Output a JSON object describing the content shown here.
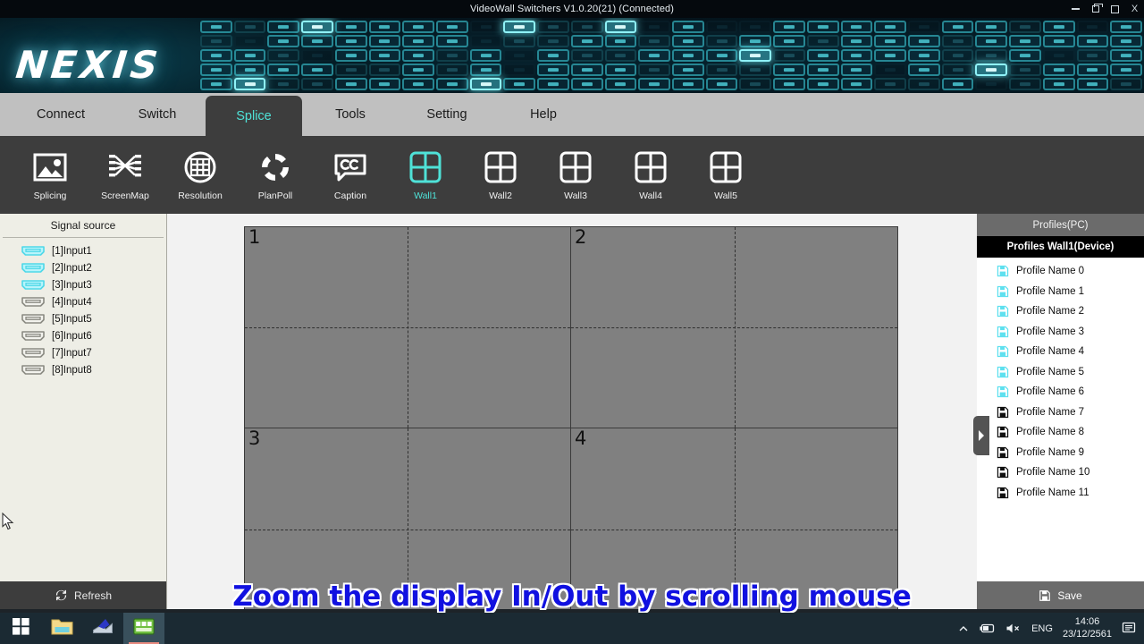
{
  "window": {
    "title": "VideoWall Switchers V1.0.20(21) (Connected)",
    "minimize_label": "Minimize",
    "restore_label": "Restore",
    "maximize_label": "Maximize",
    "close_label": "X"
  },
  "branding": {
    "logo_text": "NEXIS"
  },
  "menu": {
    "tabs": [
      {
        "label": "Connect",
        "active": false
      },
      {
        "label": "Switch",
        "active": false
      },
      {
        "label": "Splice",
        "active": true
      },
      {
        "label": "Tools",
        "active": false
      },
      {
        "label": "Setting",
        "active": false
      },
      {
        "label": "Help",
        "active": false
      }
    ]
  },
  "toolbar": {
    "buttons": [
      {
        "label": "Splicing",
        "icon": "image-icon",
        "active": false
      },
      {
        "label": "ScreenMap",
        "icon": "screenmap-icon",
        "active": false
      },
      {
        "label": "Resolution",
        "icon": "resolution-grid-circle-icon",
        "active": false
      },
      {
        "label": "PlanPoll",
        "icon": "refresh-circle-icon",
        "active": false
      },
      {
        "label": "Caption",
        "icon": "cc-bubble-icon",
        "active": false
      }
    ],
    "walls": [
      {
        "label": "Wall1",
        "icon": "grid-2x2-icon",
        "active": true
      },
      {
        "label": "Wall2",
        "icon": "grid-2x2-icon",
        "active": false
      },
      {
        "label": "Wall3",
        "icon": "grid-2x2-icon",
        "active": false
      },
      {
        "label": "Wall4",
        "icon": "grid-2x2-icon",
        "active": false
      },
      {
        "label": "Wall5",
        "icon": "grid-2x2-icon",
        "active": false
      }
    ]
  },
  "signal_source": {
    "header": "Signal source",
    "items": [
      {
        "label": "[1]Input1",
        "connected": true
      },
      {
        "label": "[2]Input2",
        "connected": true
      },
      {
        "label": "[3]Input3",
        "connected": true
      },
      {
        "label": "[4]Input4",
        "connected": false
      },
      {
        "label": "[5]Input5",
        "connected": false
      },
      {
        "label": "[6]Input6",
        "connected": false
      },
      {
        "label": "[7]Input7",
        "connected": false
      },
      {
        "label": "[8]Input8",
        "connected": false
      }
    ],
    "refresh_label": "Refresh",
    "refresh_icon": "refresh-icon"
  },
  "wall_canvas": {
    "screens": [
      "1",
      "2",
      "3",
      "4"
    ],
    "rows": 2,
    "columns": 2,
    "subdivision_rows": 2,
    "subdivision_columns": 2
  },
  "profiles": {
    "header": "Profiles(PC)",
    "subheader": "Profiles Wall1(Device)",
    "items": [
      {
        "label": "Profile Name 0",
        "saved": true
      },
      {
        "label": "Profile Name 1",
        "saved": true
      },
      {
        "label": "Profile Name 2",
        "saved": true
      },
      {
        "label": "Profile Name 3",
        "saved": true
      },
      {
        "label": "Profile Name 4",
        "saved": true
      },
      {
        "label": "Profile Name 5",
        "saved": true
      },
      {
        "label": "Profile Name 6",
        "saved": true
      },
      {
        "label": "Profile Name 7",
        "saved": false
      },
      {
        "label": "Profile Name 8",
        "saved": false
      },
      {
        "label": "Profile Name 9",
        "saved": false
      },
      {
        "label": "Profile Name 10",
        "saved": false
      },
      {
        "label": "Profile Name 11",
        "saved": false
      }
    ],
    "save_label": "Save",
    "save_icon": "floppy-icon",
    "collapse_icon": "chevron-right-icon"
  },
  "overlay": {
    "caption": "Zoom the display In/Out by scrolling mouse"
  },
  "taskbar": {
    "apps": [
      {
        "name": "start-button",
        "icon": "windows-logo-icon",
        "active": false
      },
      {
        "name": "file-explorer",
        "icon": "folder-icon",
        "active": false
      },
      {
        "name": "app-blue",
        "icon": "blue-app-icon",
        "active": false
      },
      {
        "name": "videowall-app",
        "icon": "green-app-icon",
        "active": true
      }
    ],
    "tray": {
      "chevron": "chevron-up-icon",
      "battery": "battery-icon",
      "volume": "volume-muted-icon",
      "language": "ENG",
      "time": "14:06",
      "date": "23/12/2561",
      "notifications": "notification-icon"
    }
  },
  "colors": {
    "accent_teal": "#4fe2d8",
    "toolbar_bg": "#3d3d3d",
    "menubar_bg": "#c0c0c0",
    "panel_bg": "#eeeee6",
    "wall_screen": "#808080",
    "caption_blue": "#1111e0"
  }
}
